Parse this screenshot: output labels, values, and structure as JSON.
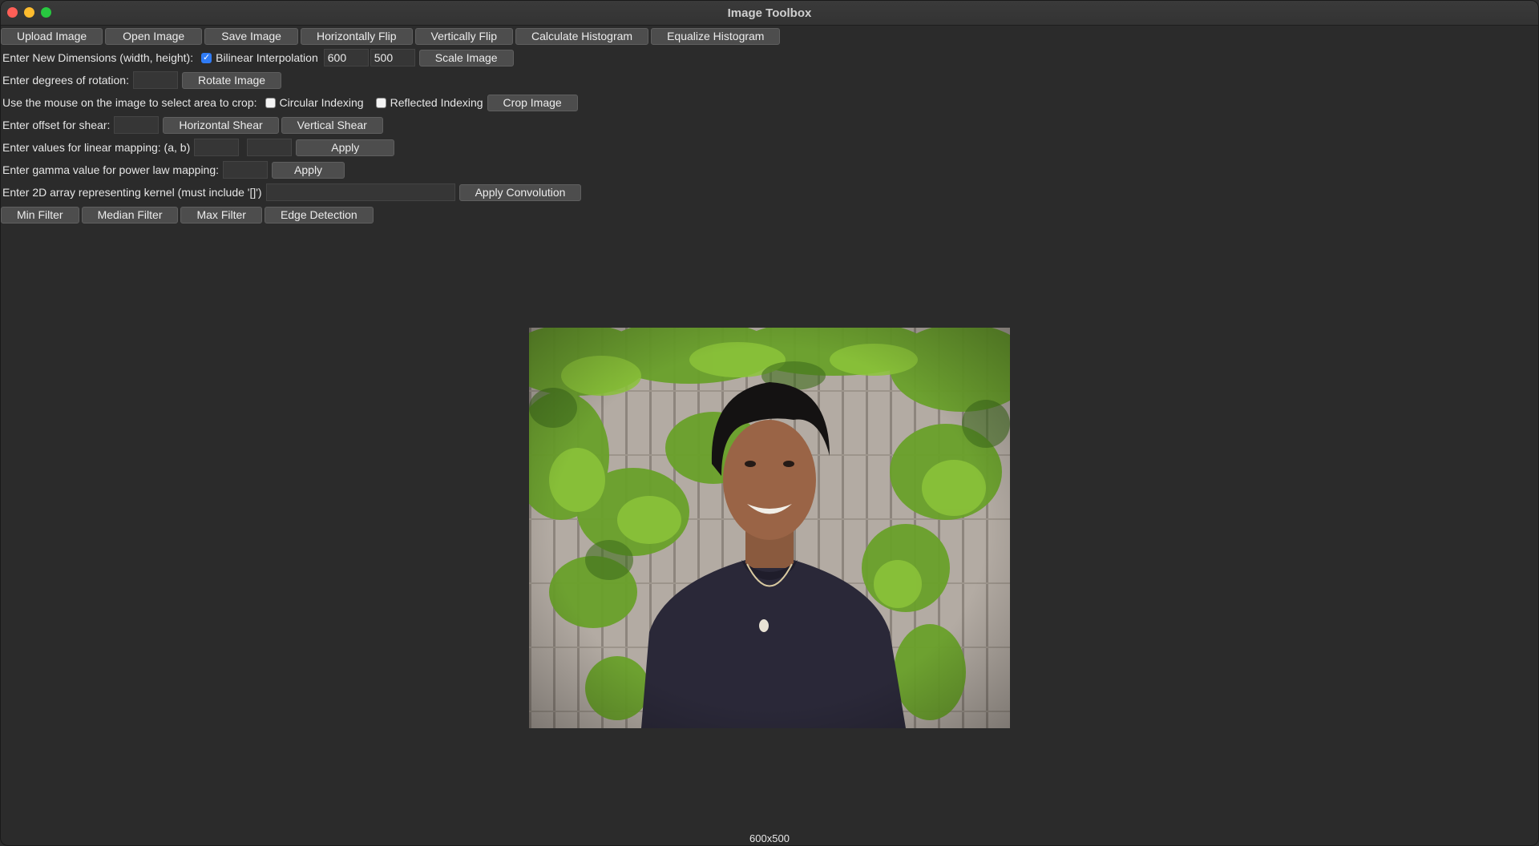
{
  "window": {
    "title": "Image Toolbox"
  },
  "toolbar": {
    "upload": "Upload Image",
    "open": "Open Image",
    "save": "Save Image",
    "hflip": "Horizontally Flip",
    "vflip": "Vertically Flip",
    "calc_hist": "Calculate Histogram",
    "eq_hist": "Equalize Histogram"
  },
  "scale": {
    "label": "Enter New Dimensions (width, height):",
    "bilinear_label": "Bilinear Interpolation",
    "bilinear_checked": true,
    "width_value": "600",
    "height_value": "500",
    "button": "Scale Image"
  },
  "rotate": {
    "label": "Enter degrees of rotation:",
    "value": "",
    "button": "Rotate Image"
  },
  "crop": {
    "label": "Use the mouse on the image to select area to crop:",
    "circular_label": "Circular Indexing",
    "reflected_label": "Reflected Indexing",
    "button": "Crop Image"
  },
  "shear": {
    "label": "Enter offset for shear:",
    "value": "",
    "horizontal": "Horizontal Shear",
    "vertical": "Vertical Shear"
  },
  "linear": {
    "label": "Enter values for linear mapping: (a, b)",
    "a": "",
    "b": "",
    "button": "Apply"
  },
  "gamma": {
    "label": "Enter gamma value for power law mapping:",
    "value": "",
    "button": "Apply"
  },
  "kernel": {
    "label": "Enter 2D array representing kernel (must include '[]')",
    "value": "",
    "button": "Apply Convolution"
  },
  "filters": {
    "min": "Min Filter",
    "median": "Median Filter",
    "max": "Max Filter",
    "edge": "Edge Detection"
  },
  "status": {
    "dimensions": "600x500"
  }
}
